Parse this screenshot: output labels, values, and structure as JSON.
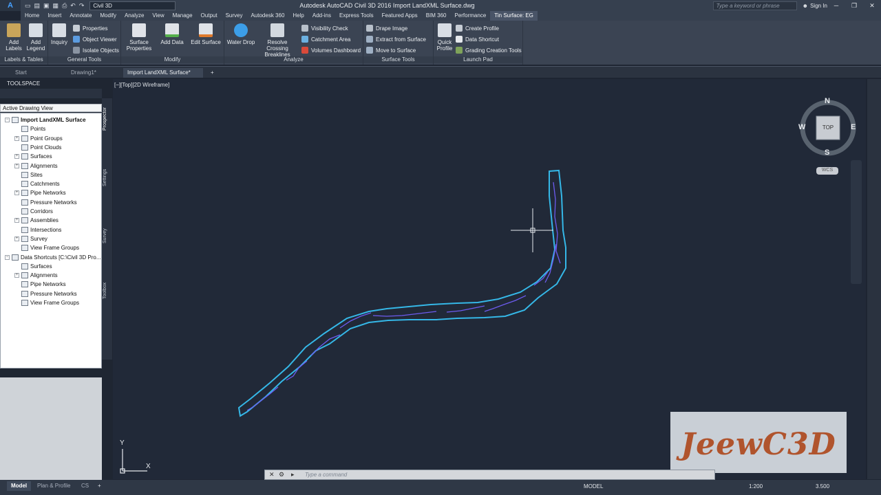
{
  "titlebar": {
    "workspace": "Civil 3D",
    "app_title": "Autodesk AutoCAD Civil 3D 2016    Import LandXML Surface.dwg",
    "search_placeholder": "Type a keyword or phrase",
    "signin": "Sign In"
  },
  "menu": [
    "Home",
    "Insert",
    "Annotate",
    "Modify",
    "Analyze",
    "View",
    "Manage",
    "Output",
    "Survey",
    "Autodesk 360",
    "Help",
    "Add-ins",
    "Express Tools",
    "Featured Apps",
    "BIM 360",
    "Performance",
    "Tin Surface: EG"
  ],
  "ribbon": {
    "labels_tables": {
      "title": "Labels & Tables",
      "add_labels": "Add Labels",
      "add_legend": "Add Legend"
    },
    "general_tools": {
      "title": "General Tools",
      "inquiry": "Inquiry",
      "properties": "Properties",
      "object_viewer": "Object Viewer",
      "isolate_objects": "Isolate Objects"
    },
    "modify": {
      "title": "Modify",
      "surface_properties": "Surface Properties",
      "add_data": "Add Data",
      "edit_surface": "Edit Surface"
    },
    "analyze": {
      "title": "Analyze",
      "water_drop": "Water Drop",
      "resolve_crossing_breaklines": "Resolve Crossing Breaklines",
      "visibility_check": "Visibility Check",
      "catchment_area": "Catchment Area",
      "volumes_dashboard": "Volumes Dashboard"
    },
    "surface_tools": {
      "title": "Surface Tools",
      "drape_image": "Drape Image",
      "extract_from_surface": "Extract from Surface",
      "move_to_surface": "Move to Surface"
    },
    "launch_pad": {
      "title": "Launch Pad",
      "quick_profile": "Quick Profile",
      "create_profile": "Create Profile",
      "data_shortcut": "Data Shortcut",
      "grading_creation_tools": "Grading Creation Tools"
    }
  },
  "doc_tabs": [
    "Start",
    "Drawing1*",
    "Import LandXML Surface*"
  ],
  "toolspace": {
    "title": "TOOLSPACE",
    "view_select": "Active Drawing View",
    "side_tabs": [
      "Prospector",
      "Settings",
      "Survey",
      "Toolbox"
    ],
    "tree": [
      {
        "label": "Import LandXML Surface",
        "level": 0,
        "expander": "−",
        "bold": true
      },
      {
        "label": "Points",
        "level": 1,
        "expander": ""
      },
      {
        "label": "Point Groups",
        "level": 1,
        "expander": "+"
      },
      {
        "label": "Point Clouds",
        "level": 1,
        "expander": ""
      },
      {
        "label": "Surfaces",
        "level": 1,
        "expander": "+"
      },
      {
        "label": "Alignments",
        "level": 1,
        "expander": "+"
      },
      {
        "label": "Sites",
        "level": 1,
        "expander": ""
      },
      {
        "label": "Catchments",
        "level": 1,
        "expander": ""
      },
      {
        "label": "Pipe Networks",
        "level": 1,
        "expander": "+"
      },
      {
        "label": "Pressure Networks",
        "level": 1,
        "expander": ""
      },
      {
        "label": "Corridors",
        "level": 1,
        "expander": ""
      },
      {
        "label": "Assemblies",
        "level": 1,
        "expander": "+"
      },
      {
        "label": "Intersections",
        "level": 1,
        "expander": ""
      },
      {
        "label": "Survey",
        "level": 1,
        "expander": "+"
      },
      {
        "label": "View Frame Groups",
        "level": 1,
        "expander": ""
      },
      {
        "label": "Data Shortcuts [C:\\Civil 3D Pro...",
        "level": 0,
        "expander": "−",
        "bold": false
      },
      {
        "label": "Surfaces",
        "level": 1,
        "expander": ""
      },
      {
        "label": "Alignments",
        "level": 1,
        "expander": "+"
      },
      {
        "label": "Pipe Networks",
        "level": 1,
        "expander": ""
      },
      {
        "label": "Pressure Networks",
        "level": 1,
        "expander": ""
      },
      {
        "label": "View Frame Groups",
        "level": 1,
        "expander": ""
      }
    ]
  },
  "viewport": {
    "label": "[−][Top][2D Wireframe]",
    "viewcube": {
      "n": "N",
      "s": "S",
      "e": "E",
      "w": "W",
      "top": "TOP",
      "wcs": "WCS"
    },
    "ucs": {
      "x": "X",
      "y": "Y"
    }
  },
  "command": {
    "placeholder": "Type a command"
  },
  "status": {
    "layout_tabs": [
      "Model",
      "Plan & Profile",
      "CS"
    ],
    "model": "MODEL",
    "scale": "1:200",
    "value": "3.500"
  },
  "watermark": "JeewC3D",
  "colors": {
    "surface_border": "#35b8e8",
    "surface_contours": "#6d5cf0",
    "background": "#212938"
  }
}
